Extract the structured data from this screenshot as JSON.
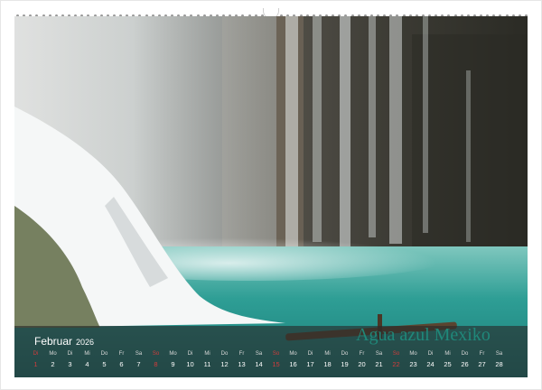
{
  "calendar": {
    "month": "Februar",
    "year": "2026",
    "watermark": "Agua azul Mexiko",
    "days": [
      {
        "wd": "Di",
        "dn": "1",
        "sun": true
      },
      {
        "wd": "Mo",
        "dn": "2"
      },
      {
        "wd": "Di",
        "dn": "3"
      },
      {
        "wd": "Mi",
        "dn": "4"
      },
      {
        "wd": "Do",
        "dn": "5"
      },
      {
        "wd": "Fr",
        "dn": "6"
      },
      {
        "wd": "Sa",
        "dn": "7"
      },
      {
        "wd": "So",
        "dn": "8",
        "sun": true
      },
      {
        "wd": "Mo",
        "dn": "9"
      },
      {
        "wd": "Di",
        "dn": "10"
      },
      {
        "wd": "Mi",
        "dn": "11"
      },
      {
        "wd": "Do",
        "dn": "12"
      },
      {
        "wd": "Fr",
        "dn": "13"
      },
      {
        "wd": "Sa",
        "dn": "14"
      },
      {
        "wd": "So",
        "dn": "15",
        "sun": true
      },
      {
        "wd": "Mo",
        "dn": "16"
      },
      {
        "wd": "Di",
        "dn": "17"
      },
      {
        "wd": "Mi",
        "dn": "18"
      },
      {
        "wd": "Do",
        "dn": "19"
      },
      {
        "wd": "Fr",
        "dn": "20"
      },
      {
        "wd": "Sa",
        "dn": "21"
      },
      {
        "wd": "So",
        "dn": "22",
        "sun": true
      },
      {
        "wd": "Mo",
        "dn": "23"
      },
      {
        "wd": "Di",
        "dn": "24"
      },
      {
        "wd": "Mi",
        "dn": "25"
      },
      {
        "wd": "Do",
        "dn": "26"
      },
      {
        "wd": "Fr",
        "dn": "27"
      },
      {
        "wd": "Sa",
        "dn": "28"
      }
    ]
  },
  "colors": {
    "water": "#2e9e95",
    "sunday": "#d23c3c",
    "watermark": "#1f8f7f"
  }
}
